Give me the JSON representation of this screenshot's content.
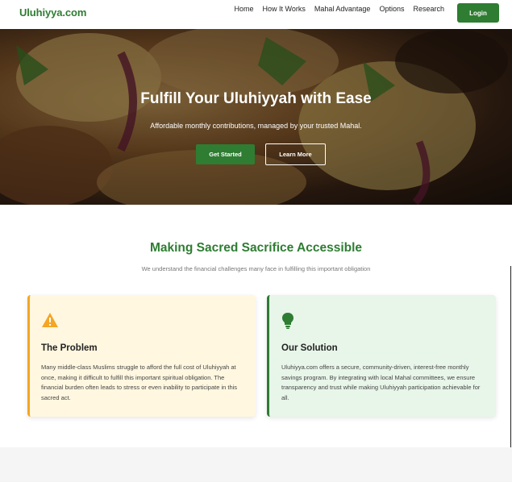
{
  "header": {
    "logo": "Uluhiyya.com",
    "nav": [
      "Home",
      "How It Works",
      "Mahal Advantage",
      "Options",
      "Research"
    ],
    "login_label": "Login"
  },
  "hero": {
    "title": "Fulfill Your Uluhiyyah with Ease",
    "subtitle": "Affordable monthly contributions, managed by your trusted Mahal.",
    "primary_button": "Get Started",
    "secondary_button": "Learn More"
  },
  "section": {
    "title": "Making Sacred Sacrifice Accessible",
    "subtitle": "We understand the financial challenges many face in fulfilling this important obligation"
  },
  "cards": {
    "problem": {
      "icon": "warning-icon",
      "title": "The Problem",
      "text": "Many middle-class Muslims struggle to afford the full cost of Uluhiyyah at once, making it difficult to fulfill this important spiritual obligation. The financial burden often leads to stress or even inability to participate in this sacred act."
    },
    "solution": {
      "icon": "lightbulb-icon",
      "title": "Our Solution",
      "text": "Uluhiyya.com offers a secure, community-driven, interest-free monthly savings program. By integrating with local Mahal committees, we ensure transparency and trust while making Uluhiyyah participation achievable for all."
    }
  },
  "colors": {
    "brand": "#2e7d32",
    "warning": "#f5a623",
    "problem_bg": "#fff7e0",
    "solution_bg": "#e8f5e9"
  }
}
